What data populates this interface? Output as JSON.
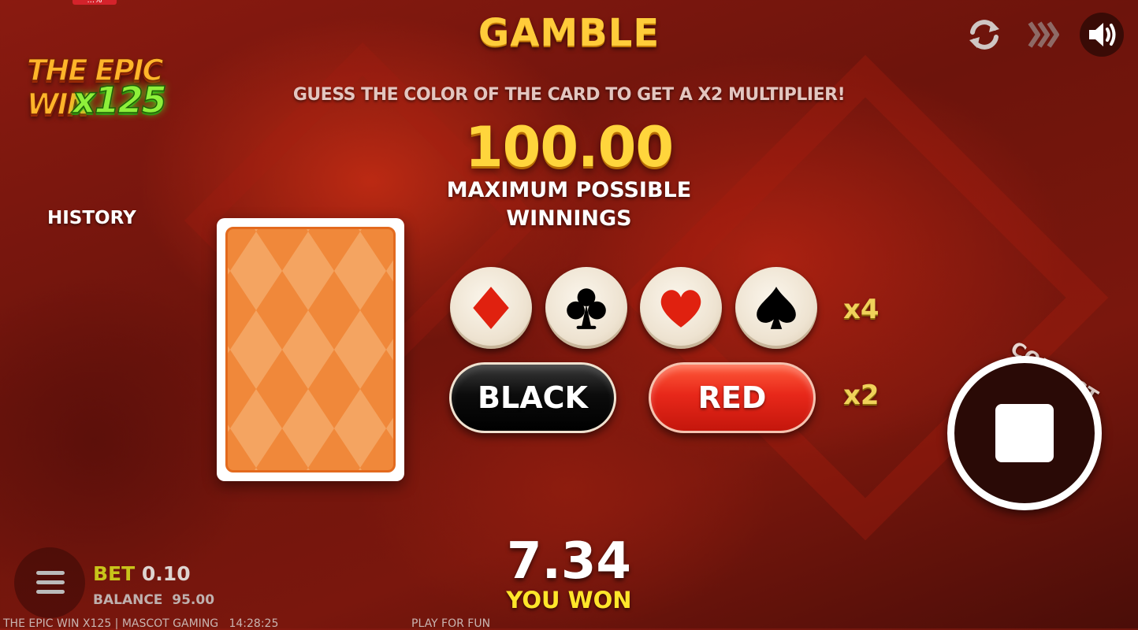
{
  "top_tag": "...%",
  "logo": {
    "line1": "THE EPIC WIN",
    "line2": "x125"
  },
  "title": "GAMBLE",
  "subtitle": "GUESS THE COLOR OF THE CARD TO GET A X2 MULTIPLIER!",
  "max_amount": "100.00",
  "max_label_1": "MAXIMUM POSSIBLE",
  "max_label_2": "WINNINGS",
  "history_label": "HISTORY",
  "suits": [
    {
      "name": "diamond-icon",
      "color": "#e0210f"
    },
    {
      "name": "club-icon",
      "color": "#000000"
    },
    {
      "name": "heart-icon",
      "color": "#e0210f"
    },
    {
      "name": "spade-icon",
      "color": "#000000"
    }
  ],
  "suit_multiplier": "x4",
  "color_multiplier": "x2",
  "buttons": {
    "black": "BLACK",
    "red": "RED"
  },
  "collect_label": "COLLECT",
  "top_icons": [
    "refresh-icon",
    "fast-forward-icon",
    "sound-icon"
  ],
  "bet": {
    "label": "BET",
    "value": "0.10"
  },
  "balance": {
    "label": "BALANCE",
    "value": "95.00"
  },
  "win": {
    "amount": "7.34",
    "label": "YOU WON"
  },
  "footer": {
    "left": "THE EPIC WIN X125 | MASCOT GAMING   14:28:25",
    "center": "PLAY FOR FUN"
  },
  "colors": {
    "gold": "#ffd53c",
    "red": "#e8281a",
    "card_back": "#f0883a"
  }
}
